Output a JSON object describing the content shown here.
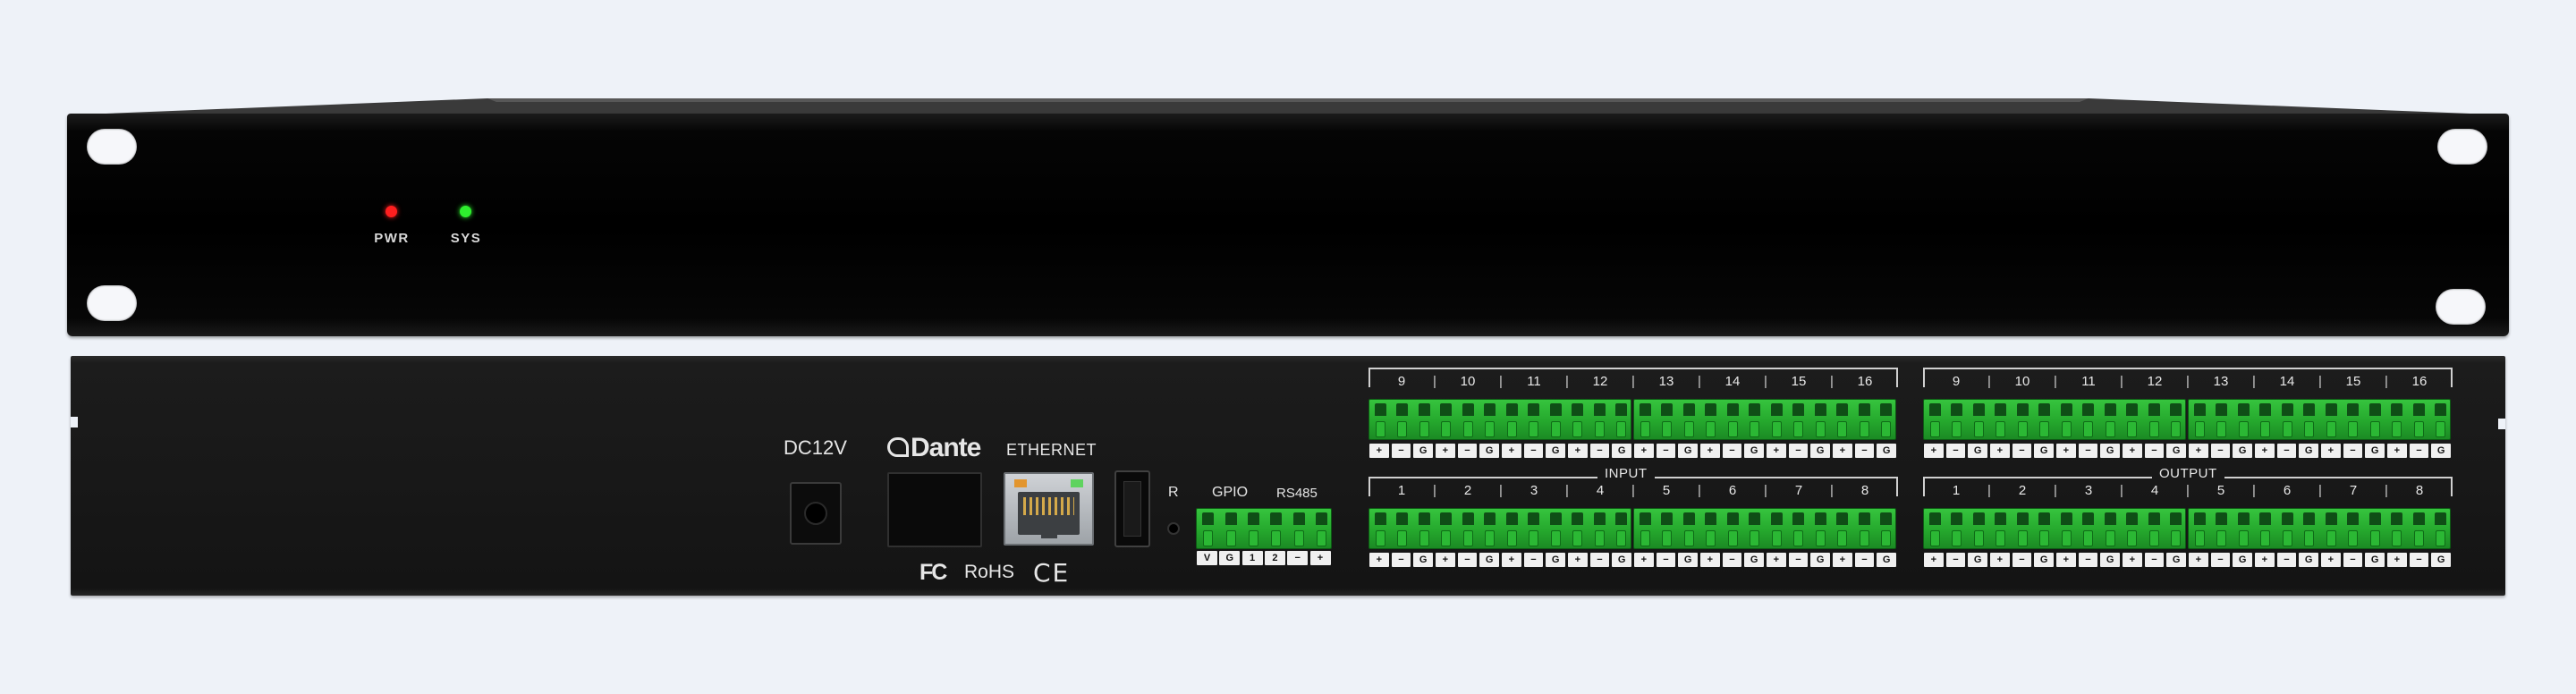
{
  "front": {
    "leds": [
      {
        "label": "PWR",
        "color": "#ff1f1f"
      },
      {
        "label": "SYS",
        "color": "#2ef02e"
      }
    ]
  },
  "rear": {
    "dc_label": "DC12V",
    "dante_logo": "Dante",
    "ethernet_label": "ETHERNET",
    "reset_label": "R",
    "gpio_label": "GPIO",
    "rs485_label": "RS485",
    "gpio_pins": [
      "V",
      "G",
      "1",
      "2",
      "−",
      "+"
    ],
    "cert_fc": "FC",
    "cert_rohs": "RoHS",
    "cert_ce": "CE",
    "input_label": "INPUT",
    "output_label": "OUTPUT",
    "channels_top": [
      "9",
      "10",
      "11",
      "12",
      "13",
      "14",
      "15",
      "16"
    ],
    "channels_bottom": [
      "1",
      "2",
      "3",
      "4",
      "5",
      "6",
      "7",
      "8"
    ],
    "channel_pins": [
      "+",
      "−",
      "G"
    ],
    "accent_green": "#2bb834"
  }
}
